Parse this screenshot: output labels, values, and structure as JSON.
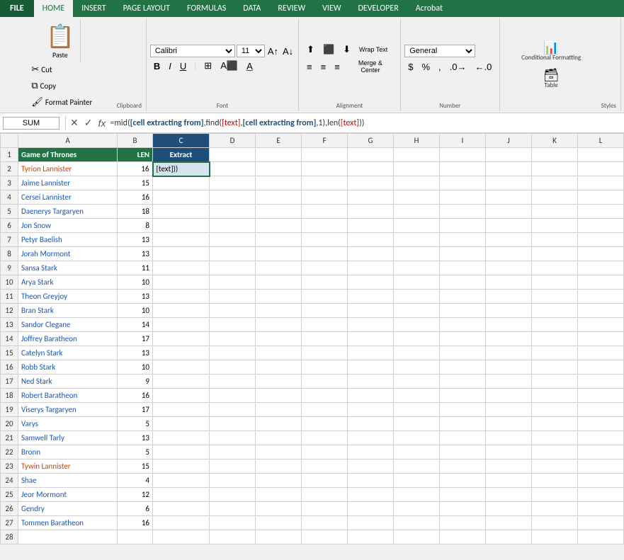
{
  "tabs": {
    "file": "FILE",
    "home": "HOME",
    "insert": "INSERT",
    "pageLayout": "PAGE LAYOUT",
    "formulas": "FORMULAS",
    "data": "DATA",
    "review": "REVIEW",
    "view": "VIEW",
    "developer": "DEVELOPER",
    "acrobat": "Acrobat"
  },
  "ribbon": {
    "clipboard": {
      "label": "Clipboard",
      "paste": "Paste",
      "cut": "Cut",
      "copy": "Copy",
      "formatPainter": "Format Painter"
    },
    "font": {
      "label": "Font",
      "fontName": "Calibri",
      "fontSize": "11",
      "bold": "B",
      "italic": "I",
      "underline": "U"
    },
    "alignment": {
      "label": "Alignment",
      "wrapText": "Wrap Text",
      "mergeCenter": "Merge & Center"
    },
    "number": {
      "label": "Number",
      "format": "General"
    },
    "styles": {
      "label": "Styles",
      "conditionalFormatting": "Conditional Formatting",
      "formatAsTable": "Format Table"
    },
    "table": {
      "label": "Table"
    }
  },
  "formulaBar": {
    "nameBox": "SUM",
    "formula": "=mid([cell extracting from],find([text],[cell extracting from],1),len([text]))"
  },
  "columns": [
    "A",
    "B",
    "C",
    "D",
    "E",
    "F",
    "G",
    "H",
    "I",
    "J",
    "K",
    "L"
  ],
  "headers": {
    "a": "Game of Thrones",
    "b": "LEN",
    "c": "Extract"
  },
  "rows": [
    {
      "num": 2,
      "name": "Tyrion Lannister",
      "len": 16,
      "extract": "[text]))",
      "nameColor": "orange"
    },
    {
      "num": 3,
      "name": "Jaime Lannister",
      "len": 15,
      "extract": "",
      "nameColor": "blue"
    },
    {
      "num": 4,
      "name": "Cersei Lannister",
      "len": 16,
      "extract": "",
      "nameColor": "blue"
    },
    {
      "num": 5,
      "name": "Daenerys Targaryen",
      "len": 18,
      "extract": "",
      "nameColor": "blue"
    },
    {
      "num": 6,
      "name": "Jon Snow",
      "len": 8,
      "extract": "",
      "nameColor": "blue"
    },
    {
      "num": 7,
      "name": "Petyr Baelish",
      "len": 13,
      "extract": "",
      "nameColor": "blue"
    },
    {
      "num": 8,
      "name": "Jorah Mormont",
      "len": 13,
      "extract": "",
      "nameColor": "blue"
    },
    {
      "num": 9,
      "name": "Sansa Stark",
      "len": 11,
      "extract": "",
      "nameColor": "blue"
    },
    {
      "num": 10,
      "name": "Arya Stark",
      "len": 10,
      "extract": "",
      "nameColor": "blue"
    },
    {
      "num": 11,
      "name": "Theon Greyjoy",
      "len": 13,
      "extract": "",
      "nameColor": "blue"
    },
    {
      "num": 12,
      "name": "Bran Stark",
      "len": 10,
      "extract": "",
      "nameColor": "blue"
    },
    {
      "num": 13,
      "name": "Sandor Clegane",
      "len": 14,
      "extract": "",
      "nameColor": "blue"
    },
    {
      "num": 14,
      "name": "Joffrey Baratheon",
      "len": 17,
      "extract": "",
      "nameColor": "blue"
    },
    {
      "num": 15,
      "name": "Catelyn Stark",
      "len": 13,
      "extract": "",
      "nameColor": "blue"
    },
    {
      "num": 16,
      "name": "Robb Stark",
      "len": 10,
      "extract": "",
      "nameColor": "blue"
    },
    {
      "num": 17,
      "name": "Ned Stark",
      "len": 9,
      "extract": "",
      "nameColor": "blue"
    },
    {
      "num": 18,
      "name": "Robert Baratheon",
      "len": 16,
      "extract": "",
      "nameColor": "blue"
    },
    {
      "num": 19,
      "name": "Viserys Targaryen",
      "len": 17,
      "extract": "",
      "nameColor": "blue"
    },
    {
      "num": 20,
      "name": "Varys",
      "len": 5,
      "extract": "",
      "nameColor": "blue"
    },
    {
      "num": 21,
      "name": "Samwell Tarly",
      "len": 13,
      "extract": "",
      "nameColor": "blue"
    },
    {
      "num": 22,
      "name": "Bronn",
      "len": 5,
      "extract": "",
      "nameColor": "blue"
    },
    {
      "num": 23,
      "name": "Tywin Lannister",
      "len": 15,
      "extract": "",
      "nameColor": "orange"
    },
    {
      "num": 24,
      "name": "Shae",
      "len": 4,
      "extract": "",
      "nameColor": "blue"
    },
    {
      "num": 25,
      "name": "Jeor Mormont",
      "len": 12,
      "extract": "",
      "nameColor": "blue"
    },
    {
      "num": 26,
      "name": "Gendry",
      "len": 6,
      "extract": "",
      "nameColor": "blue"
    },
    {
      "num": 27,
      "name": "Tommen Baratheon",
      "len": 16,
      "extract": "",
      "nameColor": "blue"
    },
    {
      "num": 28,
      "name": "",
      "len": "",
      "extract": "",
      "nameColor": "none"
    }
  ]
}
